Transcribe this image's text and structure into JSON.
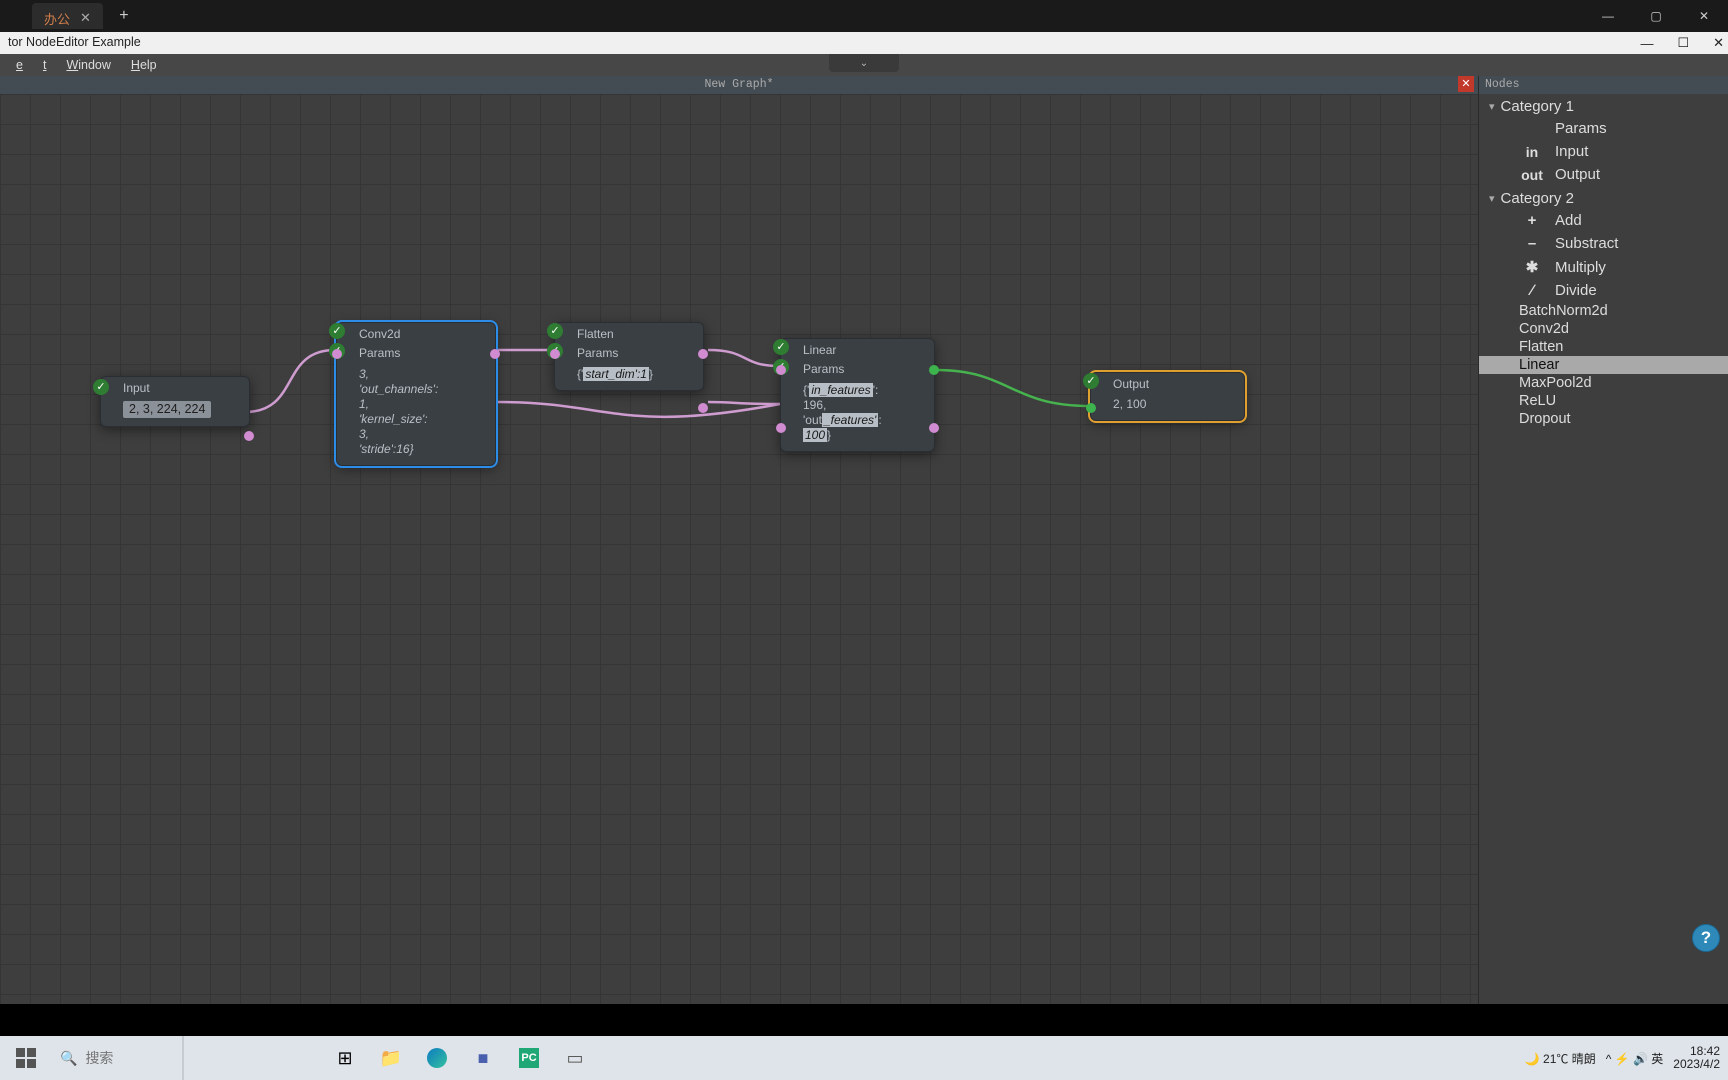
{
  "topbar": {
    "tab_label": "办公",
    "newtab_glyph": "+",
    "min": "—",
    "max": "▢",
    "close": "✕"
  },
  "app": {
    "title": "tor NodeEditor Example",
    "min": "—",
    "max": "☐",
    "close": "✕"
  },
  "menu": {
    "file": "e",
    "edit": "t",
    "window": "Window",
    "help": "Help"
  },
  "droparrow": "⌄",
  "canvas": {
    "title": "New Graph*",
    "close": "✕"
  },
  "nodes": {
    "input": {
      "title": "Input",
      "value": "2, 3, 224, 224"
    },
    "conv2d": {
      "title": "Conv2d",
      "sub": "Params",
      "body": "3,\n'out_channels':\n1,\n'kernel_size':\n3,\n'stride':16}"
    },
    "flatten": {
      "title": "Flatten",
      "sub": "Params",
      "body_pre": "{'",
      "body_hl": "start_dim':1",
      "body_post": "}"
    },
    "linear": {
      "title": "Linear",
      "sub": "Params",
      "l1_pre": "{'",
      "l1_hl": "in_features",
      "l1_post": "':",
      "l2": "196,",
      "l3_pre": "'out",
      "l3_hl": "_features'",
      "l3_post": ":",
      "l4_hl": "100",
      "l4_post": "}"
    },
    "output": {
      "title": "Output",
      "value": "2, 100"
    },
    "tick": "✓"
  },
  "side": {
    "title": "Nodes",
    "cat1": "Category 1",
    "cat1_items": {
      "params": "Params",
      "in_sym": "in",
      "in": "Input",
      "out_sym": "out",
      "out": "Output"
    },
    "cat2": "Category 2",
    "cat2_items": {
      "add": "Add",
      "sub": "Substract",
      "mul": "Multiply",
      "div": "Divide"
    },
    "syms": {
      "add": "+",
      "sub": "–",
      "mul": "✱",
      "div": "∕"
    },
    "layers": [
      "BatchNorm2d",
      "Conv2d",
      "Flatten",
      "Linear",
      "MaxPool2d",
      "ReLU",
      "Dropout"
    ],
    "selected": "Linear"
  },
  "taskbar": {
    "search_placeholder": "搜索",
    "weather": "🌙 21℃ 晴朗",
    "tray": "^  ⚡ 🔊 英",
    "time": "18:42",
    "date": "2023/4/2"
  },
  "help_glyph": "?"
}
